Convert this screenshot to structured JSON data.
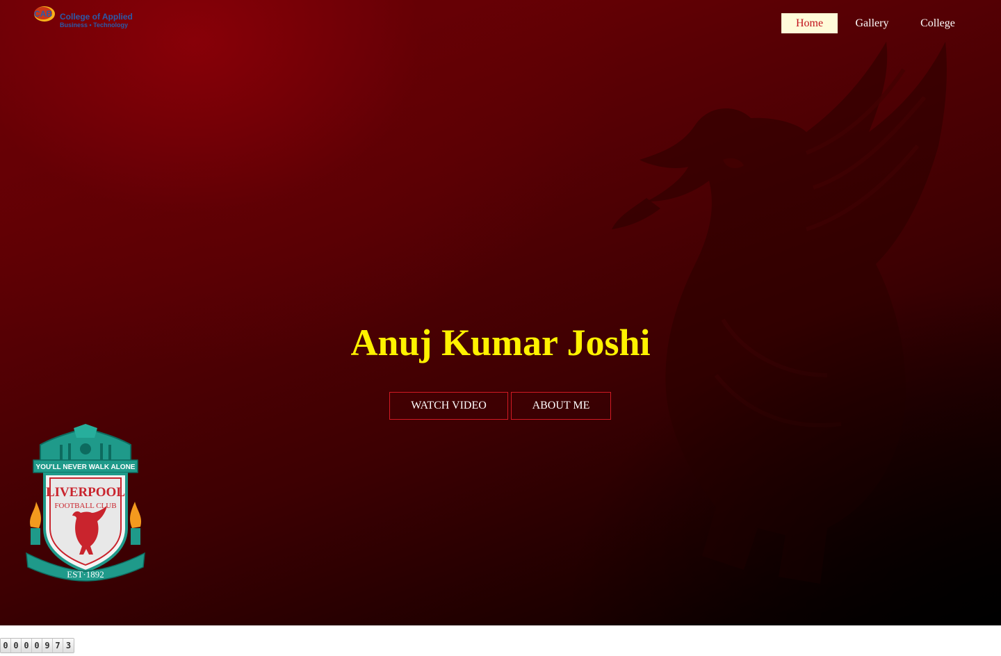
{
  "logo": {
    "mark_text": "CAB",
    "line1": "College of Applied",
    "line2": "Business • Technology",
    "color": "#2b5aa8"
  },
  "nav": {
    "items": [
      {
        "label": "Home",
        "active": true
      },
      {
        "label": "Gallery",
        "active": false
      },
      {
        "label": "College",
        "active": false
      }
    ]
  },
  "hero": {
    "title": "Anuj Kumar Joshi",
    "watch_video_label": "WATCH VIDEO",
    "about_me_label": "ABOUT ME",
    "title_color": "#fff200",
    "accent": "#d21a24"
  },
  "crest": {
    "motto": "YOU'LL NEVER WALK ALONE",
    "name1": "LIVERPOOL",
    "name2": "FOOTBALL CLUB",
    "est": "EST·1892",
    "icon": "liverpool-crest-icon"
  },
  "counter": {
    "digits": [
      "0",
      "0",
      "0",
      "0",
      "9",
      "7",
      "3"
    ]
  }
}
